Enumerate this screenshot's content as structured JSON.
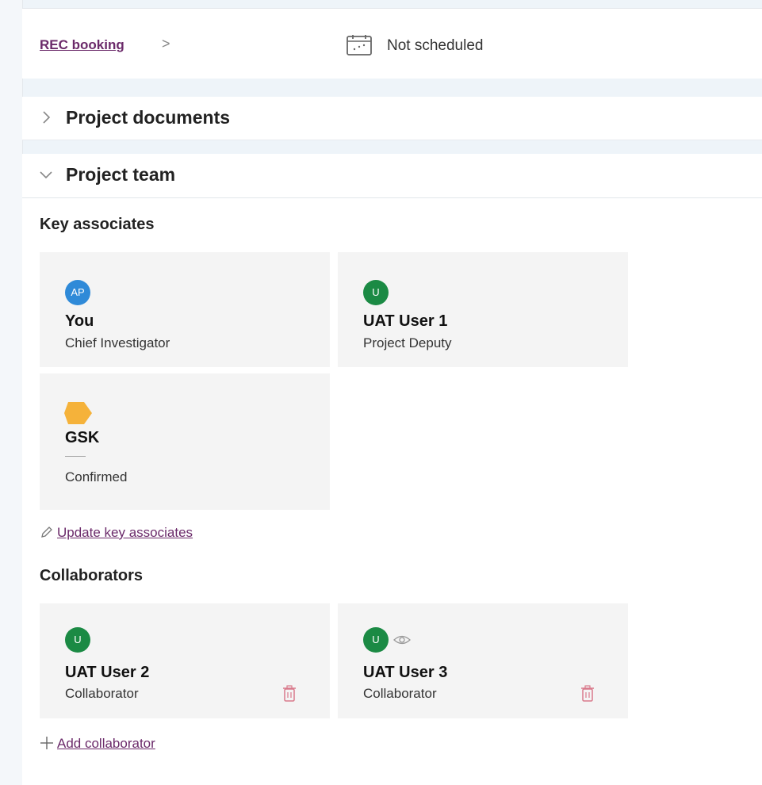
{
  "rec": {
    "link_label": "REC booking",
    "chevron": ">",
    "calendar_icon": "calendar-icon",
    "status": "Not scheduled"
  },
  "documents": {
    "title": "Project documents",
    "toggle_icon": "chevron-right-icon"
  },
  "team": {
    "title": "Project team",
    "toggle_icon": "chevron-down-icon",
    "key_associates": {
      "heading": "Key associates",
      "cards": [
        {
          "initials": "AP",
          "name": "You",
          "role": "Chief Investigator",
          "avatar_color": "#2f8ad8"
        },
        {
          "initials": "U",
          "name": "UAT User 1",
          "role": "Project Deputy",
          "avatar_color": "#1b8a44"
        },
        {
          "name": "GSK",
          "dash": "——",
          "role": "Confirmed",
          "logo_color": "#f5b23a",
          "logo_icon": "organisation-pentagon-icon"
        }
      ],
      "update_label": "Update key associates",
      "update_icon": "pencil-icon"
    },
    "collaborators": {
      "heading": "Collaborators",
      "cards": [
        {
          "initials": "U",
          "name": "UAT User 2",
          "role": "Collaborator",
          "avatar_color": "#1b8a44",
          "action_icon": "trash-icon"
        },
        {
          "initials": "U",
          "name": "UAT User 3",
          "role": "Collaborator",
          "avatar_color": "#1b8a44",
          "extra_icon": "eye-icon",
          "action_icon": "trash-icon"
        }
      ],
      "add_label": "Add collaborator",
      "add_icon": "plus-icon"
    }
  },
  "colors": {
    "link": "#6b2a6a",
    "card_background": "#f4f4f4",
    "trash": "#d9798b"
  }
}
